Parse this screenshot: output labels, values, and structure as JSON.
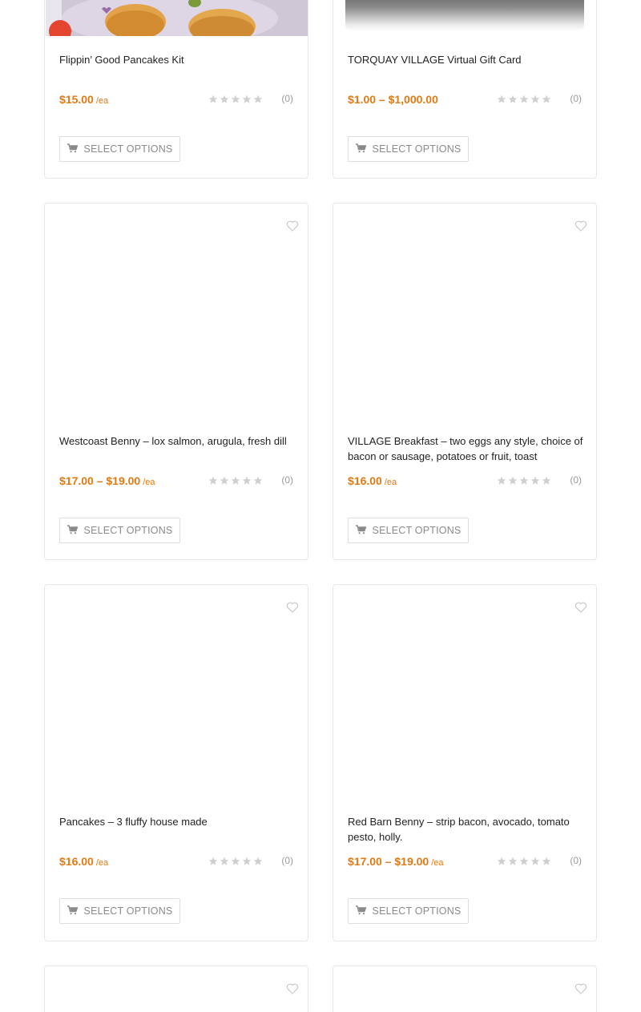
{
  "colors": {
    "accent": "#e07b14",
    "border": "#e6e6e6",
    "muted": "#9a9a9a"
  },
  "icons": {
    "wishlist": "heart-outline-icon",
    "cart": "cart-icon",
    "rating": "star-icon"
  },
  "products": [
    {
      "title": "Flippin’ Good Pancakes Kit",
      "price": "$15.00",
      "unit": "/ea",
      "rating_count": "(0)",
      "rating": 0,
      "button_label": "SELECT OPTIONS"
    },
    {
      "title": "TORQUAY VILLAGE Virtual Gift Card",
      "price": "$1.00 – $1,000.00",
      "unit": "",
      "rating_count": "(0)",
      "rating": 0,
      "button_label": "SELECT OPTIONS"
    },
    {
      "title": "Westcoast Benny – lox salmon, arugula, fresh dill",
      "price": "$17.00 – $19.00",
      "unit": "/ea",
      "rating_count": "(0)",
      "rating": 0,
      "button_label": "SELECT OPTIONS"
    },
    {
      "title": "VILLAGE Breakfast – two eggs any style, choice of bacon or sausage, potatoes or fruit, toast",
      "price": "$16.00",
      "unit": "/ea",
      "rating_count": "(0)",
      "rating": 0,
      "button_label": "SELECT OPTIONS"
    },
    {
      "title": "Pancakes – 3 fluffy house made",
      "price": "$16.00",
      "unit": "/ea",
      "rating_count": "(0)",
      "rating": 0,
      "button_label": "SELECT OPTIONS"
    },
    {
      "title": "Red Barn Benny – strip bacon, avocado, tomato pesto, holly.",
      "price": "$17.00 – $19.00",
      "unit": "/ea",
      "rating_count": "(0)",
      "rating": 0,
      "button_label": "SELECT OPTIONS"
    }
  ]
}
